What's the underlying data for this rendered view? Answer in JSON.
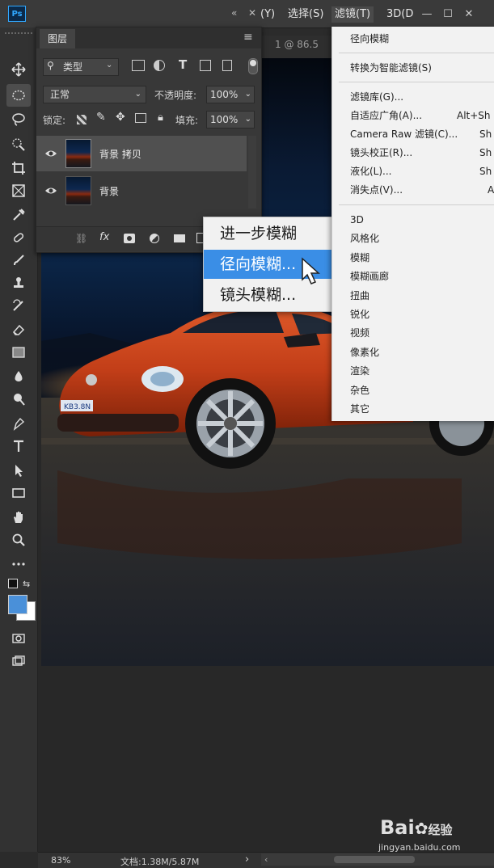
{
  "menubar": {
    "app_logo": "Ps",
    "items": [
      "(Y)",
      "选择(S)",
      "滤镜(T)",
      "3D(D"
    ],
    "collapse_glyph": "«",
    "close_glyph": "✕"
  },
  "document": {
    "tab_label": "1 @ 86.5"
  },
  "layers_panel": {
    "tab_label": "图层",
    "filter_label": "类型",
    "blend_mode": "正常",
    "opacity_label": "不透明度:",
    "opacity_value": "100%",
    "lock_label": "锁定:",
    "fill_label": "填充:",
    "fill_value": "100%",
    "layers": [
      {
        "name": "背景 拷贝",
        "selected": true
      },
      {
        "name": "背景",
        "selected": false
      }
    ],
    "footer_icons": [
      "link-icon",
      "fx-icon",
      "mask-icon",
      "adjustment-icon",
      "group-icon",
      "new-layer-icon"
    ]
  },
  "blur_submenu": {
    "items": [
      {
        "label": "进一步模糊",
        "highlighted": false
      },
      {
        "label": "径向模糊...",
        "highlighted": true
      },
      {
        "label": "镜头模糊...",
        "highlighted": false
      }
    ]
  },
  "filter_menu": {
    "top_item": "径向模糊",
    "smart_item": "转换为智能滤镜(S)",
    "group2": [
      {
        "label": "滤镜库(G)...",
        "shortcut": ""
      },
      {
        "label": "自适应广角(A)...",
        "shortcut": "Alt+Sh"
      },
      {
        "label": "Camera Raw 滤镜(C)...",
        "shortcut": "Sh"
      },
      {
        "label": "镜头校正(R)...",
        "shortcut": "Sh"
      },
      {
        "label": "液化(L)...",
        "shortcut": "Sh"
      },
      {
        "label": "消失点(V)...",
        "shortcut": "A"
      }
    ],
    "group3": [
      "3D",
      "风格化",
      "模糊",
      "模糊画廊",
      "扭曲",
      "锐化",
      "视频",
      "像素化",
      "渲染",
      "杂色",
      "其它"
    ]
  },
  "status": {
    "zoom": "83%",
    "doc_info": "文档:1.38M/5.87M",
    "arrow": "›"
  },
  "canvas_image": {
    "plate_text": "KB3.8N"
  },
  "watermark": {
    "logo": "Bai",
    "logo2": "经验",
    "url": "jingyan.baidu.com"
  },
  "colors": {
    "accent": "#3a8ee6",
    "foreground_swatch": "#4a90d9",
    "background_swatch": "#ffffff",
    "car_body": "#c8401a"
  }
}
